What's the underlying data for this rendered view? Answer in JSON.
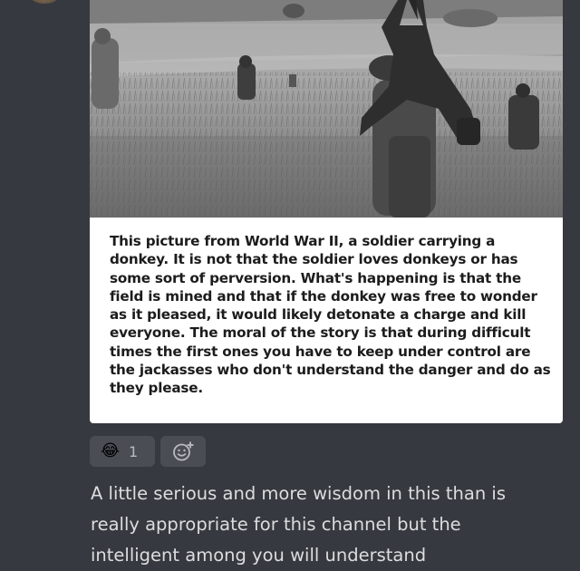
{
  "message": {
    "attachment": {
      "caption": "This picture from World War II, a soldier carrying a\ndonkey.  It is not that the soldier loves donkeys or has\nsome sort of perversion.  What's happening is that the\nfield is mined and that if the donkey was free to\nwonder as it pleased, it would likely detonate a charge\nand kill everyone.  The moral of the story is that during\ndifficult times the first ones you have to keep under\ncontrol are the jackasses who don't understand the\ndanger and do as they please."
    },
    "reactions": [
      {
        "emoji": "😂",
        "icon_name": "face-with-tears-of-joy-icon",
        "count": "1"
      }
    ],
    "add_reaction_icon": "add-reaction-icon",
    "text": "A little serious and more wisdom in this than is\nreally appropriate for this channel but the\nintelligent among you will understand"
  },
  "colors": {
    "background": "#36393f",
    "reaction_bg": "#4a4d54",
    "text": "#dcddde",
    "reaction_count": "#b9bbbe"
  }
}
